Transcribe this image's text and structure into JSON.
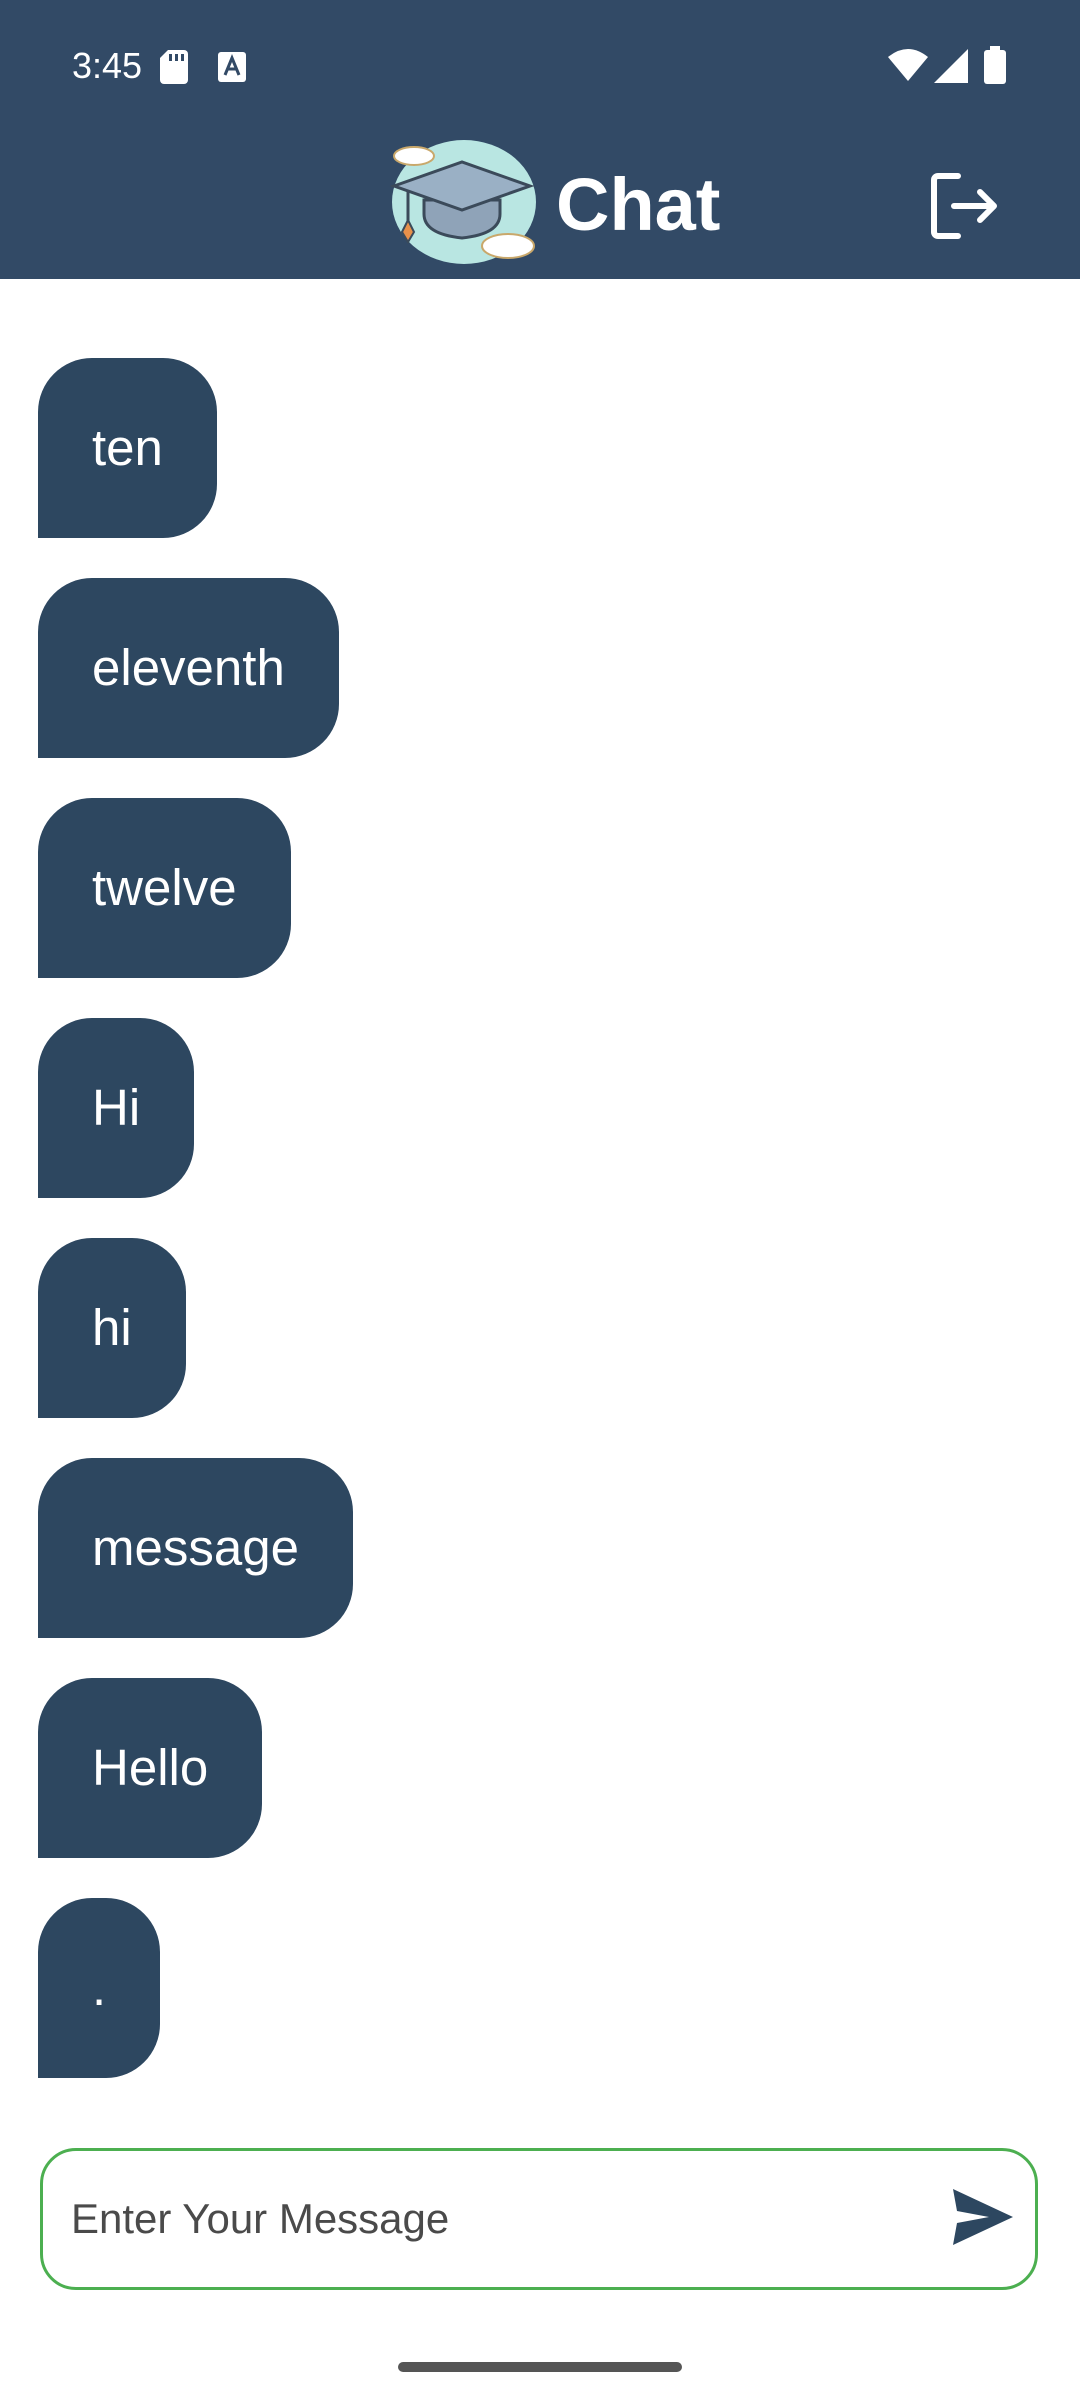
{
  "status_bar": {
    "time": "3:45",
    "icons": [
      "sd-card-icon",
      "a-notification-icon",
      "wifi-icon",
      "signal-icon",
      "battery-icon"
    ]
  },
  "header": {
    "title": "Chat",
    "logo_icon": "graduation-cap-icon",
    "logout_icon": "logout-icon",
    "background_color": "#324a66"
  },
  "messages": [
    {
      "text": "ten"
    },
    {
      "text": "eleventh"
    },
    {
      "text": "twelve"
    },
    {
      "text": "Hi"
    },
    {
      "text": "hi"
    },
    {
      "text": "message"
    },
    {
      "text": "Hello"
    },
    {
      "text": "."
    }
  ],
  "composer": {
    "placeholder": "Enter Your Message",
    "value": "",
    "send_icon": "send-icon",
    "border_color": "#4caf50"
  },
  "colors": {
    "bubble": "#2d4760",
    "accent": "#4caf50"
  }
}
